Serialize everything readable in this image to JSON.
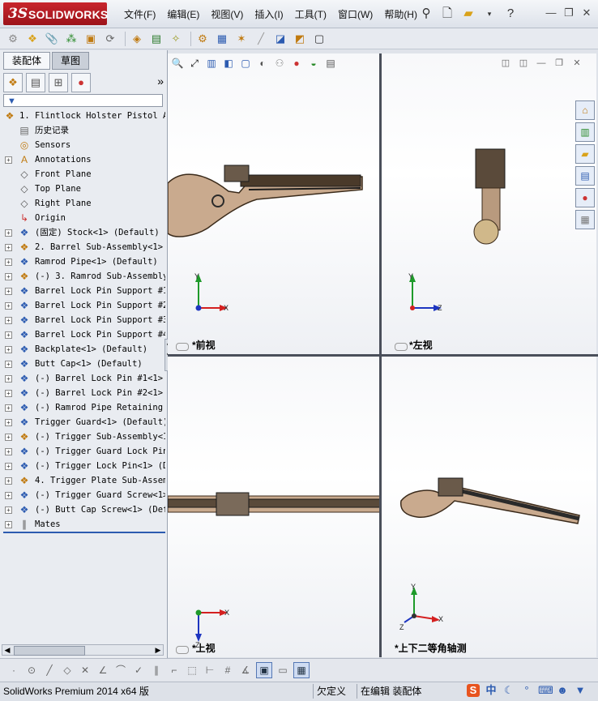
{
  "app": {
    "logo_ds": "3S",
    "logo_text": "SOLIDWORKS"
  },
  "menu": [
    "文件(F)",
    "编辑(E)",
    "视图(V)",
    "插入(I)",
    "工具(T)",
    "窗口(W)",
    "帮助(H)"
  ],
  "panel_tabs": [
    "装配体",
    "草图"
  ],
  "tree": [
    {
      "label": "1. Flintlock Holster Pistol As",
      "icon": "assembly-icon",
      "expand": "",
      "top": true
    },
    {
      "label": "历史记录",
      "icon": "history-icon",
      "expand": ""
    },
    {
      "label": "Sensors",
      "icon": "sensor-icon",
      "expand": ""
    },
    {
      "label": "Annotations",
      "icon": "annotation-icon",
      "expand": "+"
    },
    {
      "label": "Front Plane",
      "icon": "plane-icon",
      "expand": ""
    },
    {
      "label": "Top Plane",
      "icon": "plane-icon",
      "expand": ""
    },
    {
      "label": "Right Plane",
      "icon": "plane-icon",
      "expand": ""
    },
    {
      "label": "Origin",
      "icon": "origin-icon",
      "expand": ""
    },
    {
      "label": "(固定) Stock<1> (Default)",
      "icon": "part-icon",
      "expand": "+"
    },
    {
      "label": "2. Barrel Sub-Assembly<1>",
      "icon": "subassembly-icon",
      "expand": "+"
    },
    {
      "label": "Ramrod Pipe<1> (Default)",
      "icon": "part-icon",
      "expand": "+"
    },
    {
      "label": "(-) 3. Ramrod Sub-Assembly<",
      "icon": "subassembly-icon",
      "expand": "+"
    },
    {
      "label": "Barrel Lock Pin Support #1<",
      "icon": "part-icon",
      "expand": "+"
    },
    {
      "label": "Barrel Lock Pin Support #2<",
      "icon": "part-icon",
      "expand": "+"
    },
    {
      "label": "Barrel Lock Pin Support #3<",
      "icon": "part-icon",
      "expand": "+"
    },
    {
      "label": "Barrel Lock Pin Support #4<",
      "icon": "part-icon",
      "expand": "+"
    },
    {
      "label": "Backplate<1> (Default)",
      "icon": "part-icon",
      "expand": "+"
    },
    {
      "label": "Butt Cap<1> (Default)",
      "icon": "part-icon",
      "expand": "+"
    },
    {
      "label": "(-) Barrel Lock Pin #1<1>",
      "icon": "part-icon",
      "expand": "+"
    },
    {
      "label": "(-) Barrel Lock Pin #2<1>",
      "icon": "part-icon",
      "expand": "+"
    },
    {
      "label": "(-) Ramrod Pipe Retaining P",
      "icon": "part-icon",
      "expand": "+"
    },
    {
      "label": "Trigger Guard<1> (Default)",
      "icon": "part-icon",
      "expand": "+"
    },
    {
      "label": "(-) Trigger Sub-Assembly<1>",
      "icon": "subassembly-icon",
      "expand": "+"
    },
    {
      "label": "(-) Trigger Guard Lock Pin<",
      "icon": "part-icon",
      "expand": "+"
    },
    {
      "label": "(-) Trigger Lock Pin<1> (De",
      "icon": "part-icon",
      "expand": "+"
    },
    {
      "label": "4. Trigger Plate Sub-Assemb",
      "icon": "subassembly-icon",
      "expand": "+"
    },
    {
      "label": "(-) Trigger Guard Screw<1>",
      "icon": "part-icon",
      "expand": "+"
    },
    {
      "label": "(-) Butt Cap Screw<1> (Defa",
      "icon": "part-icon",
      "expand": "+"
    },
    {
      "label": "Mates",
      "icon": "mates-icon",
      "expand": "+"
    }
  ],
  "viewports": {
    "front": {
      "label": "*前视",
      "axes": [
        "Y",
        "X"
      ]
    },
    "left": {
      "label": "*左视",
      "axes": [
        "Y",
        "Z"
      ]
    },
    "top": {
      "label": "*上视",
      "axes": [
        "X",
        "Z"
      ]
    },
    "iso": {
      "label": "*上下二等角轴测",
      "axes": [
        "Y",
        "X",
        "Z"
      ]
    }
  },
  "status": {
    "product": "SolidWorks Premium 2014 x64 版",
    "underdefined": "欠定义",
    "editing": "在编辑 装配体"
  },
  "ime": {
    "logo": "S",
    "lang": "中"
  },
  "colors": {
    "brand_red": "#b81c24",
    "accent_blue": "#2c5bb0",
    "axis_red": "#d42020",
    "axis_green": "#1e9a2a",
    "axis_blue": "#1d35c0"
  }
}
